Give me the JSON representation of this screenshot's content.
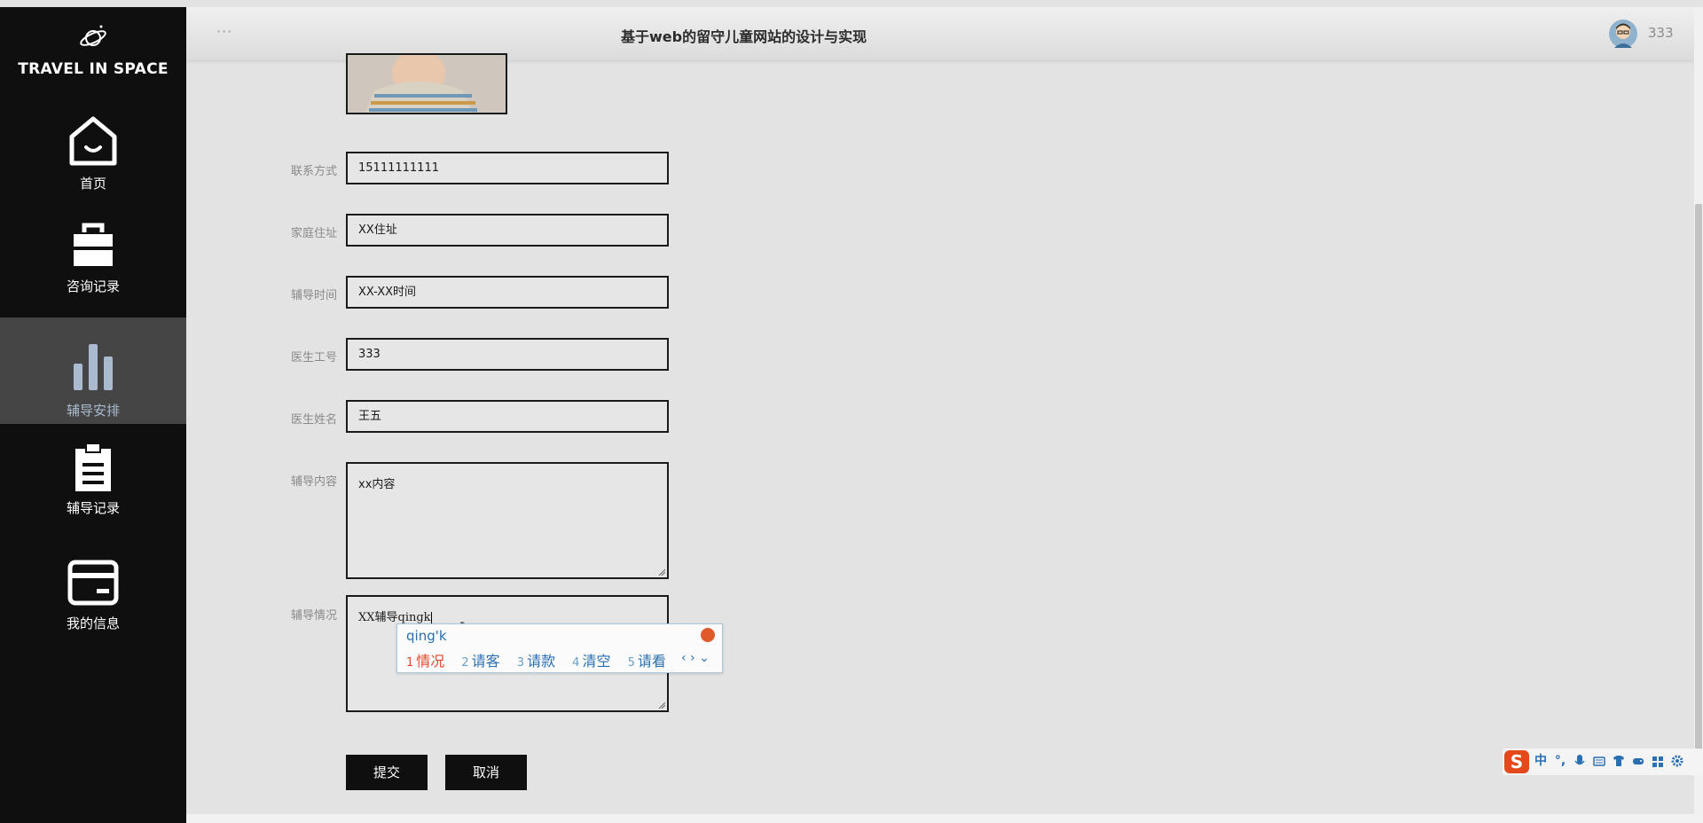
{
  "app": {
    "brand": "TRAVEL IN SPACE",
    "title": "基于web的留守儿童网站的设计与实现",
    "header_dots": "···",
    "user_name": "333"
  },
  "sidebar": {
    "items": [
      {
        "label": "首页",
        "icon": "home-icon",
        "active": false
      },
      {
        "label": "咨询记录",
        "icon": "briefcase-icon",
        "active": false
      },
      {
        "label": "辅导安排",
        "icon": "bar-chart-icon",
        "active": true
      },
      {
        "label": "辅导记录",
        "icon": "clipboard-icon",
        "active": false
      },
      {
        "label": "我的信息",
        "icon": "card-icon",
        "active": false
      }
    ]
  },
  "form": {
    "fields": [
      {
        "label": "联系方式",
        "value": "15111111111"
      },
      {
        "label": "家庭住址",
        "value": "XX住址"
      },
      {
        "label": "辅导时间",
        "value": "XX-XX时间"
      },
      {
        "label": "医生工号",
        "value": "333"
      },
      {
        "label": "医生姓名",
        "value": "王五"
      }
    ],
    "content_label": "辅导内容",
    "content_value": "xx内容",
    "situation_label": "辅导情况",
    "situation_value": "XX辅导qingk",
    "submit_label": "提交",
    "cancel_label": "取消"
  },
  "ime": {
    "pinyin": "qing'k",
    "candidates": [
      {
        "num": "1",
        "text": "情况"
      },
      {
        "num": "2",
        "text": "请客"
      },
      {
        "num": "3",
        "text": "请款"
      },
      {
        "num": "4",
        "text": "清空"
      },
      {
        "num": "5",
        "text": "请看"
      }
    ],
    "nav": "‹ › ⌄",
    "toolbar_logo": "S",
    "toolbar_mode": "中"
  },
  "colors": {
    "sidebar_bg": "#0f0f0f",
    "active_item_bg": "#454545",
    "content_bg": "#e3e3e3",
    "button_bg": "#0f0f0f",
    "ime_highlight": "#e3472d",
    "ime_text": "#2a6fb0"
  }
}
